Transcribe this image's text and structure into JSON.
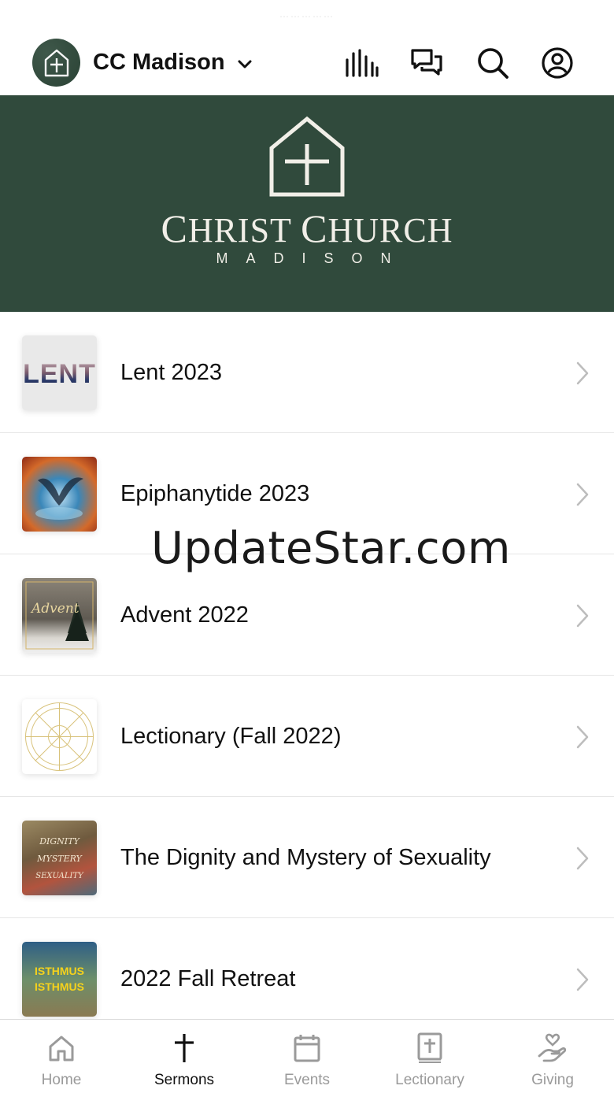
{
  "header": {
    "status_text": "⋯⋯⋯⋯⋯",
    "church_name": "CC Madison",
    "icons": [
      "media-bars-icon",
      "chat-bubbles-icon",
      "search-icon",
      "account-icon"
    ]
  },
  "banner": {
    "title_first": "C",
    "title_rest1": "HRIST ",
    "title_c2": "C",
    "title_rest2": "HURCH",
    "subtitle": "MADISON",
    "background_color": "#304a3c"
  },
  "sermon_series": [
    {
      "title": "Lent 2023",
      "thumb": "lent-thumb",
      "thumb_text": "LENT"
    },
    {
      "title": "Epiphanytide 2023",
      "thumb": "epiphany-thumb"
    },
    {
      "title": "Advent 2022",
      "thumb": "advent-thumb",
      "thumb_text": "Advent"
    },
    {
      "title": "Lectionary (Fall 2022)",
      "thumb": "lectionary-thumb"
    },
    {
      "title": "The Dignity and Mystery of Sexuality",
      "thumb": "dignity-thumb",
      "thumb_lines": [
        "DIGNITY",
        "MYSTERY",
        "SEXUALITY"
      ]
    },
    {
      "title": "2022 Fall Retreat",
      "thumb": "retreat-thumb",
      "thumb_lines": [
        "ISTHMUS",
        "ISTHMUS"
      ]
    }
  ],
  "watermark": "UpdateStar.com",
  "tabbar": {
    "tabs": [
      {
        "label": "Home",
        "icon": "home-icon",
        "active": false
      },
      {
        "label": "Sermons",
        "icon": "cross-icon",
        "active": true
      },
      {
        "label": "Events",
        "icon": "calendar-icon",
        "active": false
      },
      {
        "label": "Lectionary",
        "icon": "bible-icon",
        "active": false
      },
      {
        "label": "Giving",
        "icon": "giving-hand-icon",
        "active": false
      }
    ]
  },
  "colors": {
    "brand_green": "#304a3c",
    "active_tab": "#111111",
    "inactive_tab": "#9a9a9a"
  }
}
